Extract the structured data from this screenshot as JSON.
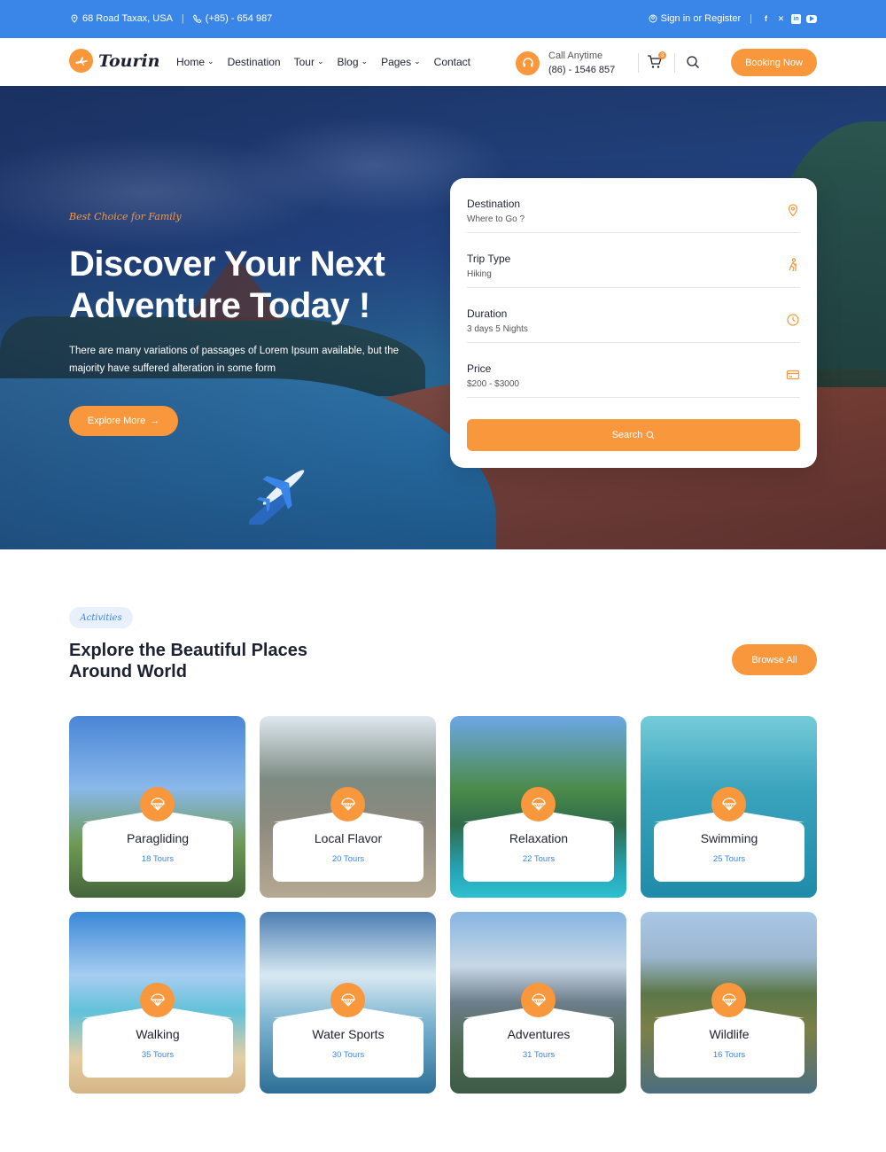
{
  "topbar": {
    "address": "68 Road Taxax, USA",
    "phone": "(+85) - 654 987",
    "signin": "Sign in or Register",
    "social_icons": [
      "facebook-icon",
      "x-icon",
      "linkedin-icon",
      "youtube-icon"
    ]
  },
  "brand": {
    "name": "Tourin",
    "accent": "#f8973c",
    "blue": "#3a85e8"
  },
  "nav": {
    "items": [
      {
        "label": "Home",
        "dropdown": true
      },
      {
        "label": "Destination",
        "dropdown": false
      },
      {
        "label": "Tour",
        "dropdown": true
      },
      {
        "label": "Blog",
        "dropdown": true
      },
      {
        "label": "Pages",
        "dropdown": true
      },
      {
        "label": "Contact",
        "dropdown": false
      }
    ],
    "call_label": "Call Anytime",
    "call_number": "(86) - 1546 857",
    "cart_count": "3",
    "cta": "Booking Now"
  },
  "hero": {
    "tagline": "Best Choice for Family",
    "title": "Discover Your Next Adventure Today !",
    "description": "There are many variations of passages of Lorem Ipsum available, but the majority have suffered alteration in some form",
    "button": "Explore More"
  },
  "search": {
    "fields": [
      {
        "label": "Destination",
        "value": "Where to Go ?",
        "icon": "map-pin-icon"
      },
      {
        "label": "Trip Type",
        "value": "Hiking",
        "icon": "hiker-icon"
      },
      {
        "label": "Duration",
        "value": "3 days 5 Nights",
        "icon": "clock-icon"
      },
      {
        "label": "Price",
        "value": "$200 - $3000",
        "icon": "credit-card-icon"
      }
    ],
    "button": "Search"
  },
  "activities": {
    "pill": "Activities",
    "title": "Explore the Beautiful Places Around World",
    "browse": "Browse All",
    "cards": [
      {
        "name": "Paragliding",
        "count": "18 Tours"
      },
      {
        "name": "Local Flavor",
        "count": "20 Tours"
      },
      {
        "name": "Relaxation",
        "count": "22 Tours"
      },
      {
        "name": "Swimming",
        "count": "25 Tours"
      },
      {
        "name": "Walking",
        "count": "35 Tours"
      },
      {
        "name": "Water Sports",
        "count": "30 Tours"
      },
      {
        "name": "Adventures",
        "count": "31 Tours"
      },
      {
        "name": "Wildlife",
        "count": "16 Tours"
      }
    ]
  }
}
